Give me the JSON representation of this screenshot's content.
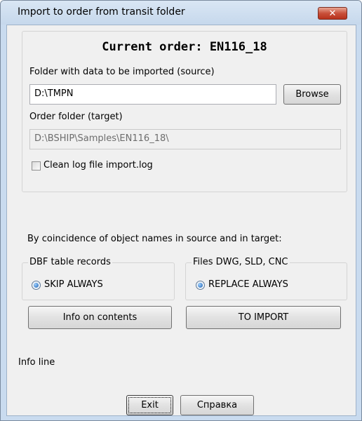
{
  "window": {
    "title": "Import to order from transit folder",
    "close_glyph": "✕"
  },
  "order": {
    "title": "Current order:  EN116_18"
  },
  "source": {
    "label": "Folder with data to be imported (source)",
    "value": "D:\\TMPN",
    "browse_label": "Browse"
  },
  "target": {
    "label": "Order folder (target)",
    "value": "D:\\BSHIP\\Samples\\EN116_18\\"
  },
  "clean_log": {
    "label": "Clean log file import.log",
    "checked": false
  },
  "coincidence": {
    "label": "By coincidence of object names in source and in target:"
  },
  "dbf_group": {
    "title": "DBF table records",
    "option": "SKIP ALWAYS"
  },
  "files_group": {
    "title": "Files DWG, SLD, CNC",
    "option": "REPLACE ALWAYS"
  },
  "actions": {
    "info_label": "Info on contents",
    "import_label": "TO IMPORT"
  },
  "info_line": "Info line",
  "footer": {
    "exit_label": "Exit",
    "help_label": "Справка"
  }
}
